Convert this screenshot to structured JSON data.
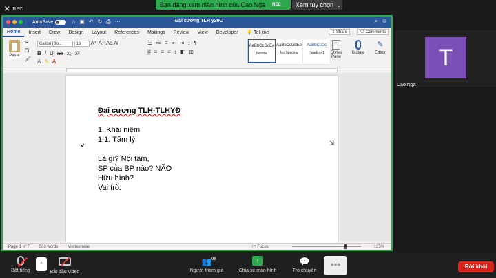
{
  "zoom": {
    "top_left": "REC",
    "share_banner": "Bạn đang xem màn hình của Cao Nga",
    "share_banner_rec": "REC",
    "view_options": "Xem tùy chọn",
    "participant": {
      "initial": "T",
      "name": "Cao Nga"
    },
    "toolbar": {
      "mute": "Bật tiếng",
      "video": "Bắt đầu video",
      "participants": "Người tham gia",
      "participants_count": "98",
      "share": "Chia sẻ màn hình",
      "chat": "Trò chuyện",
      "more": "•••",
      "leave": "Rời khỏi"
    },
    "colors": {
      "share_green": "#2ea84f",
      "leave_red": "#d9261c",
      "avatar_purple": "#7b4fb5"
    }
  },
  "word": {
    "titlebar": {
      "autosave": "AutoSave",
      "toggle": "OFF",
      "doc_title": "Đại cương TLH y20C"
    },
    "tabs": [
      "Home",
      "Insert",
      "Draw",
      "Design",
      "Layout",
      "References",
      "Mailings",
      "Review",
      "View",
      "Developer",
      "Tell me"
    ],
    "share_label": "Share",
    "comments_label": "Comments",
    "ribbon": {
      "paste": "Paste",
      "font_name": "Calibri (Bo...",
      "font_size": "16",
      "styles": [
        {
          "sample": "AaBbCcDdEe",
          "name": "Normal"
        },
        {
          "sample": "AaBbCcDdEe",
          "name": "No Spacing"
        },
        {
          "sample": "AaBbCcDc",
          "name": "Heading 1"
        }
      ],
      "styles_pane": "Styles Pane",
      "dictate": "Dictate",
      "editor": "Editor"
    },
    "document": {
      "title": "Đại cương TLH-TLHYĐ",
      "line1": "1. Khái niệm",
      "line2": "1.1. Tâm lý",
      "line3": "Là gì? Nội tâm,",
      "line4": "SP của BP nào? NÃO",
      "line5": "Hữu hình?",
      "line6": "Vai trò:"
    },
    "status": {
      "page": "Page 1 of 7",
      "words": "560 words",
      "language": "Vietnamese",
      "focus": "Focus",
      "zoom": "135%"
    },
    "colors": {
      "brand": "#2b579a"
    }
  }
}
